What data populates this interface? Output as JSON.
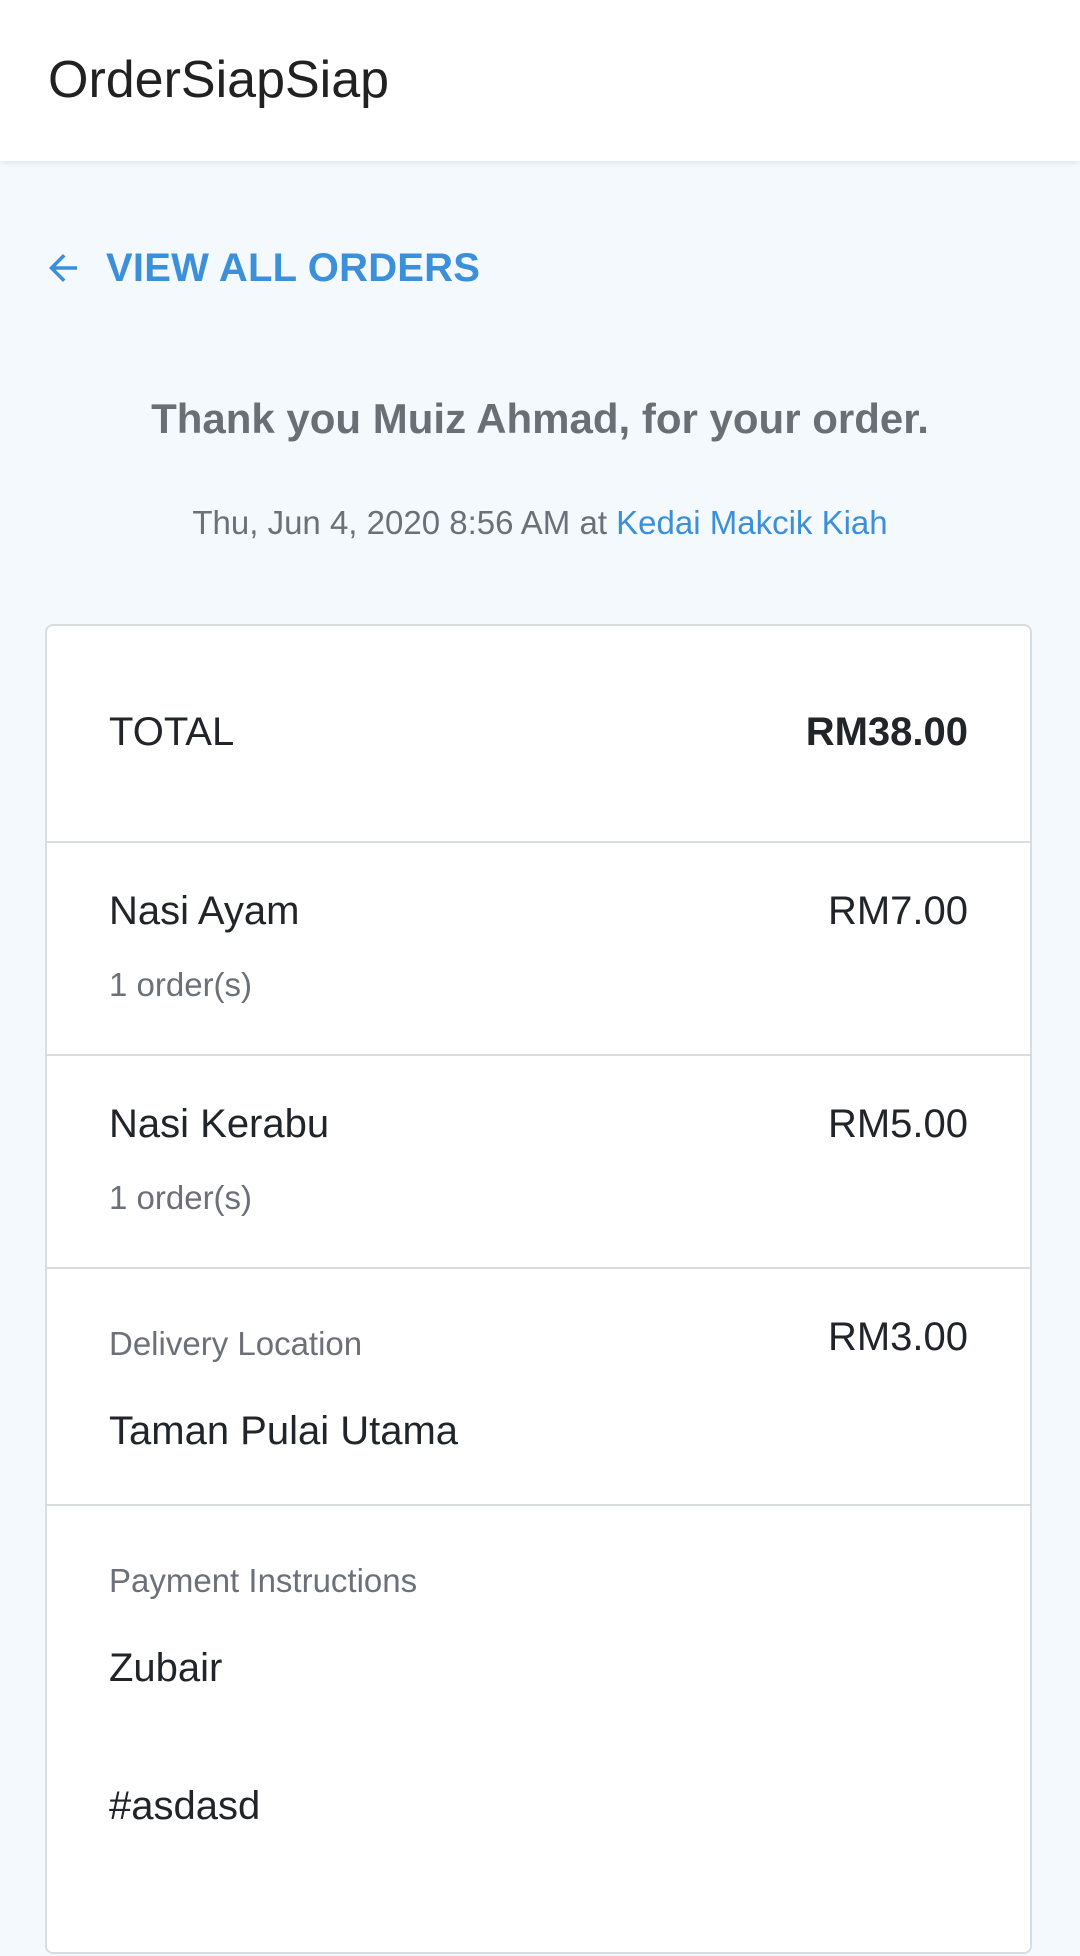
{
  "app": {
    "title": "OrderSiapSiap"
  },
  "nav": {
    "back_label": "VIEW ALL ORDERS"
  },
  "order": {
    "thanks_prefix": "Thank you ",
    "customer_name": "Muiz Ahmad",
    "thanks_suffix": ", for your order.",
    "datetime": "Thu, Jun 4, 2020 8:56 AM",
    "at_word": " at ",
    "shop_name": "Kedai Makcik Kiah"
  },
  "summary": {
    "total_label": "TOTAL",
    "total_amount": "RM38.00",
    "items": [
      {
        "name": "Nasi Ayam",
        "qty": "1 order(s)",
        "price": "RM7.00"
      },
      {
        "name": "Nasi Kerabu",
        "qty": "1 order(s)",
        "price": "RM5.00"
      }
    ],
    "delivery": {
      "label": "Delivery Location",
      "location": "Taman Pulai Utama",
      "fee": "RM3.00"
    },
    "payment": {
      "label": "Payment Instructions",
      "lines": [
        "Zubair",
        "#asdasd"
      ]
    }
  },
  "colors": {
    "accent": "#3c8fd9",
    "page_bg": "#f3f9fd",
    "muted_text": "#6b7079"
  }
}
